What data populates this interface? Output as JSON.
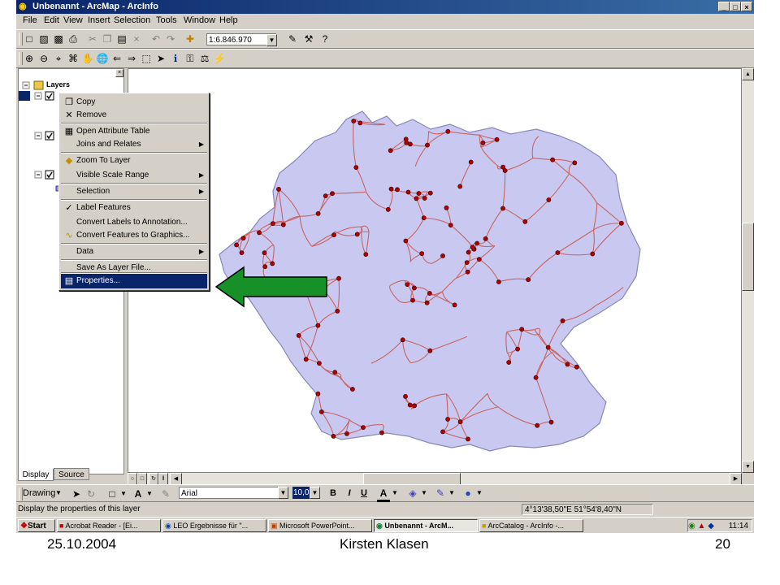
{
  "window": {
    "title": "Unbenannt - ArcMap - ArcInfo"
  },
  "menu": [
    "File",
    "Edit",
    "View",
    "Insert",
    "Selection",
    "Tools",
    "Window",
    "Help"
  ],
  "toolbar": {
    "scale": "1:6.846.970"
  },
  "toc": {
    "root": "Layers",
    "tabs": [
      "Display",
      "Source"
    ]
  },
  "context_menu": {
    "items": [
      {
        "label": "Copy",
        "icon": "copy-icon"
      },
      {
        "label": "Remove",
        "icon": "remove-icon"
      },
      {
        "label": "Open Attribute Table",
        "icon": "table-icon"
      },
      {
        "label": "Joins and Relates",
        "submenu": true
      },
      {
        "label": "Zoom To Layer",
        "icon": "zoom-to-layer-icon"
      },
      {
        "label": "Visible Scale Range",
        "submenu": true
      },
      {
        "label": "Selection",
        "submenu": true
      },
      {
        "label": "Label Features",
        "icon": "check-icon"
      },
      {
        "label": "Convert Labels to Annotation..."
      },
      {
        "label": "Convert Features to Graphics...",
        "icon": "convert-icon"
      },
      {
        "label": "Data",
        "submenu": true
      },
      {
        "label": "Save As Layer File..."
      },
      {
        "label": "Properties...",
        "icon": "properties-icon",
        "highlighted": true
      }
    ]
  },
  "drawing": {
    "label": "Drawing",
    "font": "Arial",
    "size": "10,0",
    "bold": "B",
    "italic": "I",
    "underline": "U",
    "text": "A"
  },
  "status": {
    "message": "Display the properties of this layer",
    "coords": "4°13'38,50\"E  51°54'8,40\"N"
  },
  "taskbar": {
    "start": "Start",
    "tasks": [
      "Acrobat Reader - [Ei...",
      "LEO Ergebnisse für \"...",
      "Microsoft PowerPoint...",
      "Unbenannt - ArcM...",
      "ArcCatalog - ArcInfo -..."
    ],
    "active_index": 3,
    "clock": "11:14"
  },
  "footer": {
    "date": "25.10.2004",
    "author": "Kirsten Klasen",
    "page": "20"
  },
  "colors": {
    "map_fill": "#c8c8f0",
    "roads": "#c86464",
    "points": "#b00000",
    "arrow": "#189028",
    "highlight": "#0a246a"
  }
}
